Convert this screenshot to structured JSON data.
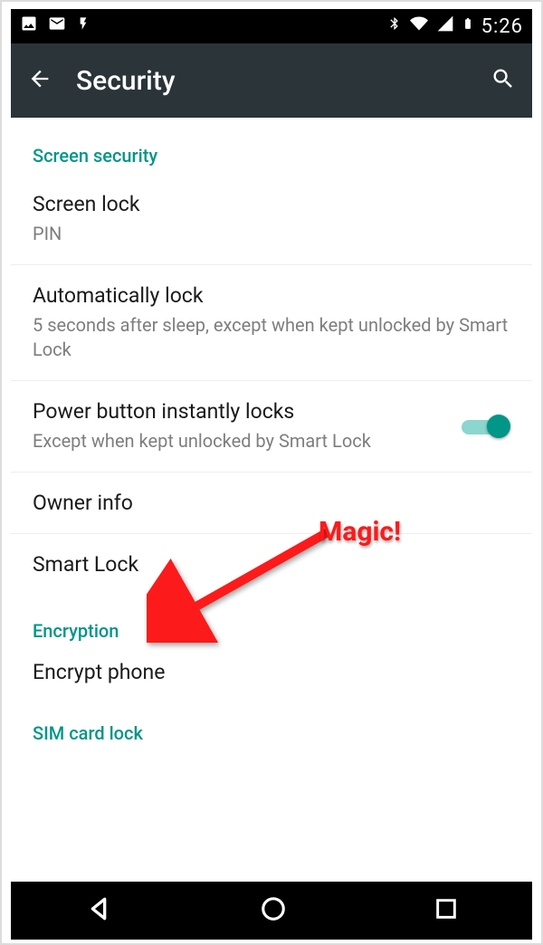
{
  "status": {
    "time": "5:26"
  },
  "appbar": {
    "title": "Security"
  },
  "sections": {
    "screen_security": {
      "header": "Screen security",
      "screen_lock": {
        "title": "Screen lock",
        "value": "PIN"
      },
      "auto_lock": {
        "title": "Automatically lock",
        "value": "5 seconds after sleep, except when kept unlocked by Smart Lock"
      },
      "power_lock": {
        "title": "Power button instantly locks",
        "value": "Except when kept unlocked by Smart Lock",
        "toggle": true
      },
      "owner_info": {
        "title": "Owner info"
      },
      "smart_lock": {
        "title": "Smart Lock"
      }
    },
    "encryption": {
      "header": "Encryption",
      "encrypt": {
        "title": "Encrypt phone"
      }
    },
    "sim": {
      "header": "SIM card lock"
    }
  },
  "annotation": {
    "label": "Magic!"
  }
}
